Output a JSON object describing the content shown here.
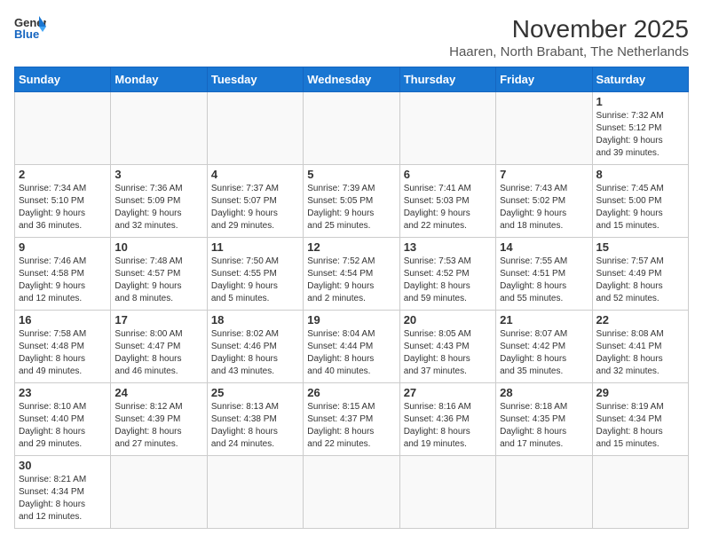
{
  "header": {
    "logo_general": "General",
    "logo_blue": "Blue",
    "title": "November 2025",
    "subtitle": "Haaren, North Brabant, The Netherlands"
  },
  "days_of_week": [
    "Sunday",
    "Monday",
    "Tuesday",
    "Wednesday",
    "Thursday",
    "Friday",
    "Saturday"
  ],
  "weeks": [
    [
      {
        "day": "",
        "info": ""
      },
      {
        "day": "",
        "info": ""
      },
      {
        "day": "",
        "info": ""
      },
      {
        "day": "",
        "info": ""
      },
      {
        "day": "",
        "info": ""
      },
      {
        "day": "",
        "info": ""
      },
      {
        "day": "1",
        "info": "Sunrise: 7:32 AM\nSunset: 5:12 PM\nDaylight: 9 hours\nand 39 minutes."
      }
    ],
    [
      {
        "day": "2",
        "info": "Sunrise: 7:34 AM\nSunset: 5:10 PM\nDaylight: 9 hours\nand 36 minutes."
      },
      {
        "day": "3",
        "info": "Sunrise: 7:36 AM\nSunset: 5:09 PM\nDaylight: 9 hours\nand 32 minutes."
      },
      {
        "day": "4",
        "info": "Sunrise: 7:37 AM\nSunset: 5:07 PM\nDaylight: 9 hours\nand 29 minutes."
      },
      {
        "day": "5",
        "info": "Sunrise: 7:39 AM\nSunset: 5:05 PM\nDaylight: 9 hours\nand 25 minutes."
      },
      {
        "day": "6",
        "info": "Sunrise: 7:41 AM\nSunset: 5:03 PM\nDaylight: 9 hours\nand 22 minutes."
      },
      {
        "day": "7",
        "info": "Sunrise: 7:43 AM\nSunset: 5:02 PM\nDaylight: 9 hours\nand 18 minutes."
      },
      {
        "day": "8",
        "info": "Sunrise: 7:45 AM\nSunset: 5:00 PM\nDaylight: 9 hours\nand 15 minutes."
      }
    ],
    [
      {
        "day": "9",
        "info": "Sunrise: 7:46 AM\nSunset: 4:58 PM\nDaylight: 9 hours\nand 12 minutes."
      },
      {
        "day": "10",
        "info": "Sunrise: 7:48 AM\nSunset: 4:57 PM\nDaylight: 9 hours\nand 8 minutes."
      },
      {
        "day": "11",
        "info": "Sunrise: 7:50 AM\nSunset: 4:55 PM\nDaylight: 9 hours\nand 5 minutes."
      },
      {
        "day": "12",
        "info": "Sunrise: 7:52 AM\nSunset: 4:54 PM\nDaylight: 9 hours\nand 2 minutes."
      },
      {
        "day": "13",
        "info": "Sunrise: 7:53 AM\nSunset: 4:52 PM\nDaylight: 8 hours\nand 59 minutes."
      },
      {
        "day": "14",
        "info": "Sunrise: 7:55 AM\nSunset: 4:51 PM\nDaylight: 8 hours\nand 55 minutes."
      },
      {
        "day": "15",
        "info": "Sunrise: 7:57 AM\nSunset: 4:49 PM\nDaylight: 8 hours\nand 52 minutes."
      }
    ],
    [
      {
        "day": "16",
        "info": "Sunrise: 7:58 AM\nSunset: 4:48 PM\nDaylight: 8 hours\nand 49 minutes."
      },
      {
        "day": "17",
        "info": "Sunrise: 8:00 AM\nSunset: 4:47 PM\nDaylight: 8 hours\nand 46 minutes."
      },
      {
        "day": "18",
        "info": "Sunrise: 8:02 AM\nSunset: 4:46 PM\nDaylight: 8 hours\nand 43 minutes."
      },
      {
        "day": "19",
        "info": "Sunrise: 8:04 AM\nSunset: 4:44 PM\nDaylight: 8 hours\nand 40 minutes."
      },
      {
        "day": "20",
        "info": "Sunrise: 8:05 AM\nSunset: 4:43 PM\nDaylight: 8 hours\nand 37 minutes."
      },
      {
        "day": "21",
        "info": "Sunrise: 8:07 AM\nSunset: 4:42 PM\nDaylight: 8 hours\nand 35 minutes."
      },
      {
        "day": "22",
        "info": "Sunrise: 8:08 AM\nSunset: 4:41 PM\nDaylight: 8 hours\nand 32 minutes."
      }
    ],
    [
      {
        "day": "23",
        "info": "Sunrise: 8:10 AM\nSunset: 4:40 PM\nDaylight: 8 hours\nand 29 minutes."
      },
      {
        "day": "24",
        "info": "Sunrise: 8:12 AM\nSunset: 4:39 PM\nDaylight: 8 hours\nand 27 minutes."
      },
      {
        "day": "25",
        "info": "Sunrise: 8:13 AM\nSunset: 4:38 PM\nDaylight: 8 hours\nand 24 minutes."
      },
      {
        "day": "26",
        "info": "Sunrise: 8:15 AM\nSunset: 4:37 PM\nDaylight: 8 hours\nand 22 minutes."
      },
      {
        "day": "27",
        "info": "Sunrise: 8:16 AM\nSunset: 4:36 PM\nDaylight: 8 hours\nand 19 minutes."
      },
      {
        "day": "28",
        "info": "Sunrise: 8:18 AM\nSunset: 4:35 PM\nDaylight: 8 hours\nand 17 minutes."
      },
      {
        "day": "29",
        "info": "Sunrise: 8:19 AM\nSunset: 4:34 PM\nDaylight: 8 hours\nand 15 minutes."
      }
    ],
    [
      {
        "day": "30",
        "info": "Sunrise: 8:21 AM\nSunset: 4:34 PM\nDaylight: 8 hours\nand 12 minutes."
      },
      {
        "day": "",
        "info": ""
      },
      {
        "day": "",
        "info": ""
      },
      {
        "day": "",
        "info": ""
      },
      {
        "day": "",
        "info": ""
      },
      {
        "day": "",
        "info": ""
      },
      {
        "day": "",
        "info": ""
      }
    ]
  ]
}
